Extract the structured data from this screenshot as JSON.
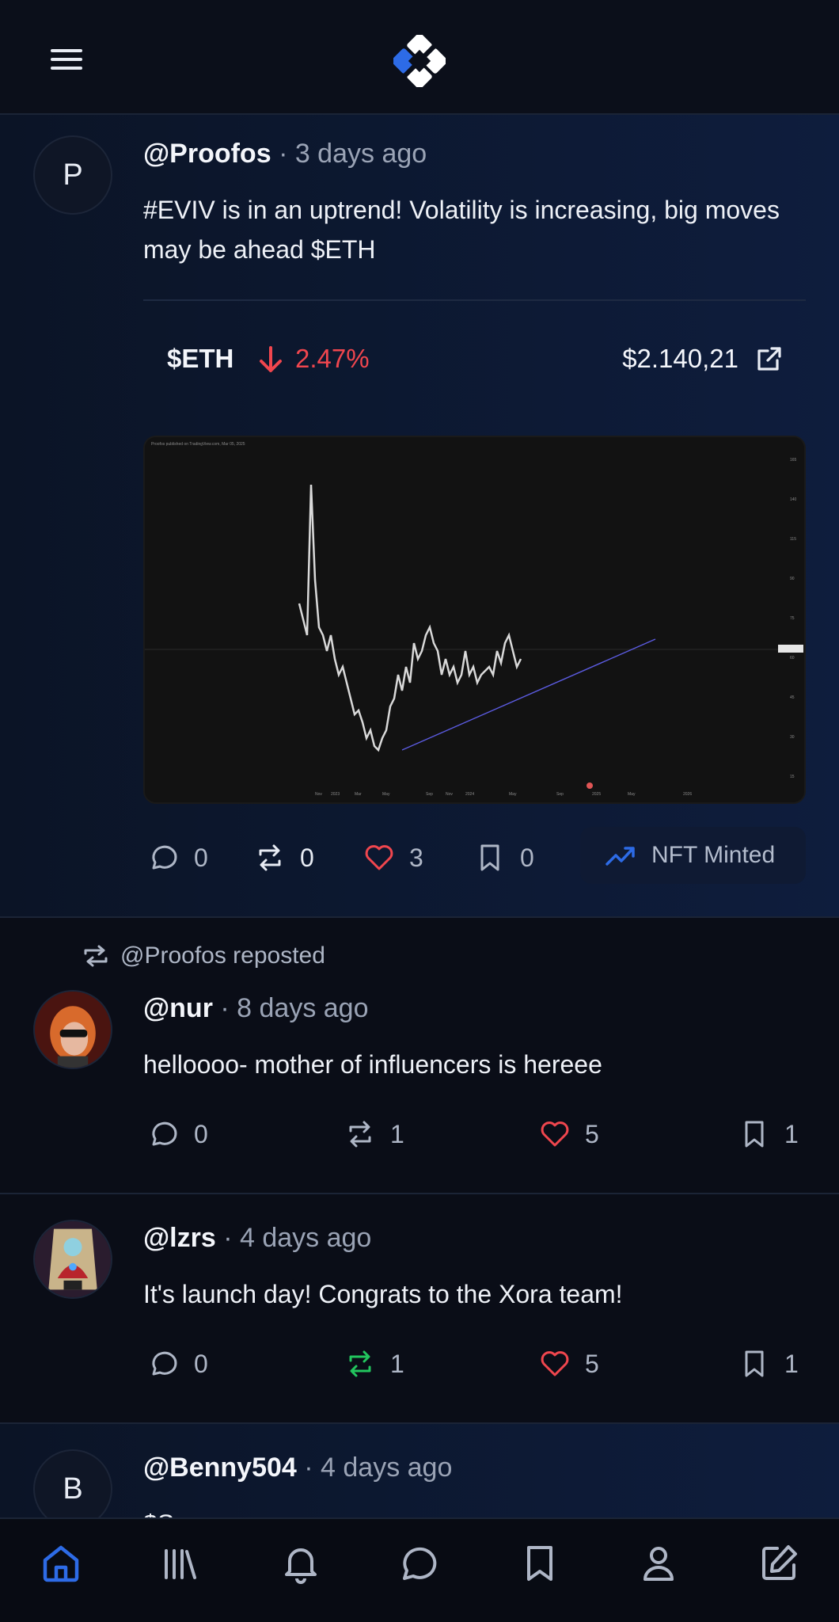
{
  "app": {
    "logo": "xora-logo"
  },
  "topbar": {
    "menu_icon": "hamburger-menu-icon"
  },
  "colors": {
    "accent_blue": "#2d6be6",
    "down_red": "#f0464e",
    "like_red": "#f0464e",
    "repost_green": "#22c55e",
    "background": "#0a0d17"
  },
  "posts": [
    {
      "avatar_letter": "P",
      "handle": "@Proofos",
      "time": "· 3 days ago",
      "text": "#EVIV is in an uptrend! Volatility is increasing, big moves may be ahead $ETH",
      "ticker": {
        "symbol": "$ETH",
        "change": "2.47%",
        "direction": "down",
        "price": "$2.140,21"
      },
      "chart_image": "TradingView ETH implied volatility chart",
      "stats": {
        "comments": "0",
        "reposts": "0",
        "likes": "3",
        "bookmarks": "0"
      },
      "badge": "NFT Minted"
    },
    {
      "repost_label": "@Proofos reposted",
      "handle": "@nur",
      "time": "· 8 days ago",
      "text": "helloooo- mother of influencers is hereee",
      "stats": {
        "comments": "0",
        "reposts": "1",
        "likes": "5",
        "bookmarks": "1"
      }
    },
    {
      "handle": "@lzrs",
      "time": "· 4 days ago",
      "text": "It's launch day! Congrats to the Xora team!",
      "stats": {
        "comments": "0",
        "reposts": "1",
        "likes": "5",
        "bookmarks": "1"
      }
    },
    {
      "avatar_letter": "B",
      "handle": "@Benny504",
      "time": "· 4 days ago",
      "text": "$S..."
    }
  ],
  "bottom_nav": [
    {
      "icon": "home-icon",
      "active": true
    },
    {
      "icon": "library-icon",
      "active": false
    },
    {
      "icon": "bell-icon",
      "active": false
    },
    {
      "icon": "chat-icon",
      "active": false
    },
    {
      "icon": "bookmark-icon",
      "active": false
    },
    {
      "icon": "profile-icon",
      "active": false
    },
    {
      "icon": "compose-icon",
      "active": false
    }
  ]
}
